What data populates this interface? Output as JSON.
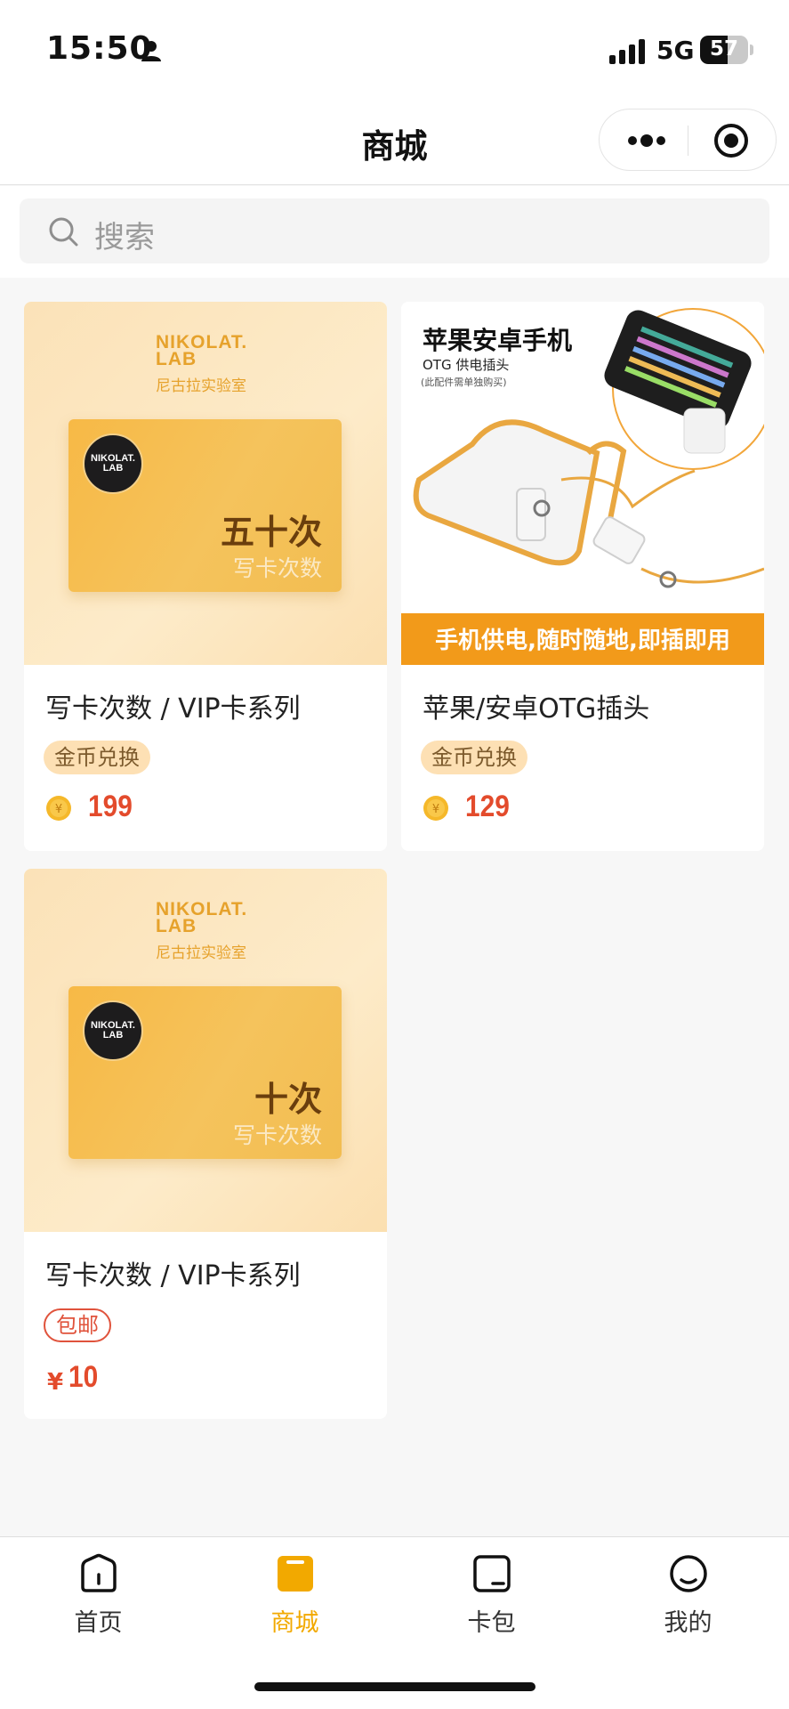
{
  "status": {
    "time": "15:50",
    "network": "5G",
    "battery": "57",
    "battery_level": 0.57
  },
  "nav": {
    "title": "商城"
  },
  "search": {
    "placeholder": "搜索"
  },
  "products": [
    {
      "title": "写卡次数 / VIP卡系列",
      "tag": "金币兑换",
      "price": "199",
      "image": {
        "brand": "NIKOLAT.\nLAB",
        "brand_cn": "尼古拉实验室",
        "logo_text": "NIKOLAT.\nLAB",
        "big": "五十次",
        "small": "写卡次数"
      }
    },
    {
      "title": "苹果/安卓OTG插头",
      "tag": "金币兑换",
      "price": "129",
      "image": {
        "h1": "苹果安卓手机",
        "h2": "OTG 供电插头",
        "h3": "(此配件需单独购买)",
        "banner": "手机供电,随时随地,即插即用"
      }
    },
    {
      "title": "写卡次数 / VIP卡系列",
      "tag": "包邮",
      "currency": "¥",
      "price": "10",
      "image": {
        "brand": "NIKOLAT.\nLAB",
        "brand_cn": "尼古拉实验室",
        "logo_text": "NIKOLAT.\nLAB",
        "big": "十次",
        "small": "写卡次数"
      }
    }
  ],
  "tabs": [
    {
      "label": "首页",
      "icon": "home-icon"
    },
    {
      "label": "商城",
      "icon": "shop-icon"
    },
    {
      "label": "卡包",
      "icon": "card-wallet-icon"
    },
    {
      "label": "我的",
      "icon": "profile-icon"
    }
  ],
  "colors": {
    "accent": "#f2a900",
    "price": "#e34b2c",
    "coin_tag_bg": "#fde0b4"
  }
}
